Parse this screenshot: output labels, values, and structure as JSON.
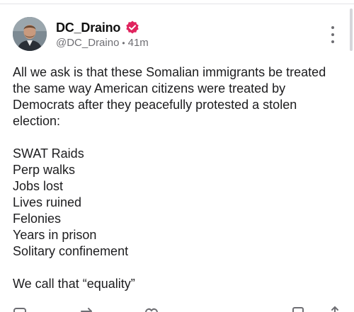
{
  "author": {
    "display_name": "DC_Draino",
    "handle": "@DC_Draino",
    "separator": "•",
    "time": "41m",
    "verified": true,
    "verified_color": "#e0245e"
  },
  "post": {
    "intro": "All we ask is that these Somalian immigrants be treated the same way American citizens were treated by Democrats after they peacefully protested a stolen election:",
    "list": [
      "SWAT Raids",
      "Perp walks",
      "Jobs lost",
      "Lives ruined",
      "Felonies",
      "Years in prison",
      "Solitary confinement"
    ],
    "closing": "We call that “equality”"
  },
  "icons": {
    "verified": "verified-badge-icon",
    "more": "more-vertical-icon",
    "comment": "comment-icon",
    "repost": "repost-icon",
    "like": "heart-icon",
    "bookmark": "bookmark-icon",
    "share": "share-icon"
  }
}
